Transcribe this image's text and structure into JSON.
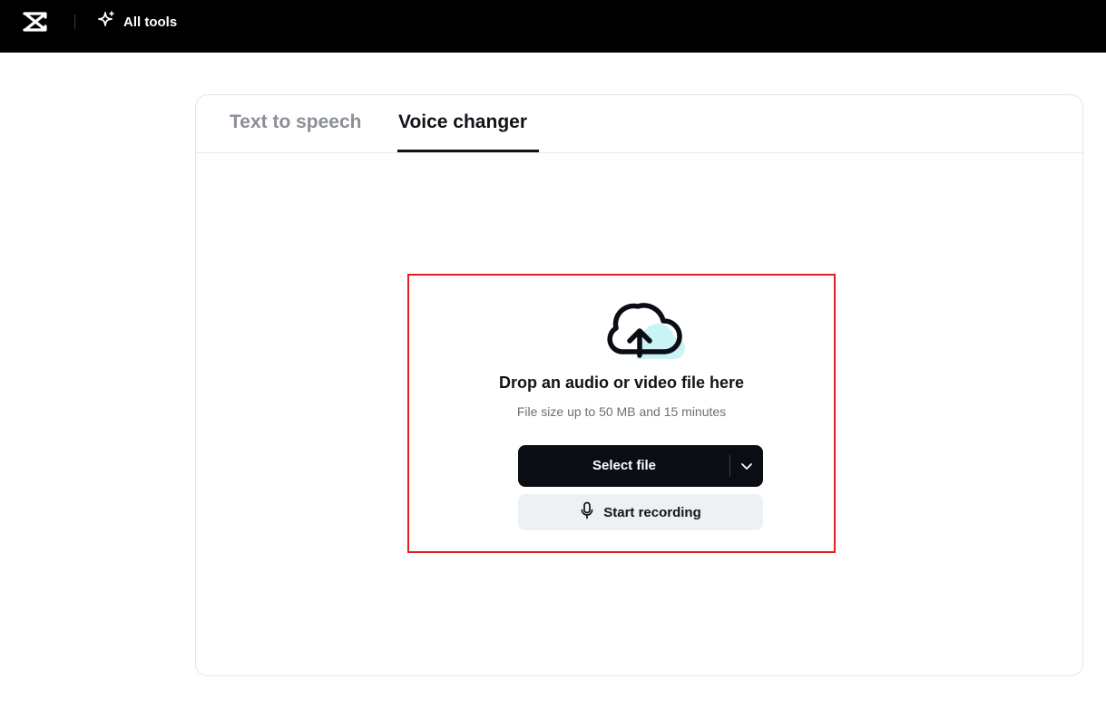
{
  "header": {
    "logo_icon": "capcut-logo-icon",
    "all_tools_icon": "sparkle-icon",
    "all_tools_label": "All tools"
  },
  "tabs": [
    {
      "label": "Text to speech",
      "active": false
    },
    {
      "label": "Voice changer",
      "active": true
    }
  ],
  "upload": {
    "icon": "cloud-upload-icon",
    "title": "Drop an audio or video file here",
    "subtitle": "File size up to 50 MB and 15 minutes",
    "select_button_label": "Select file",
    "dropdown_icon": "chevron-down-icon",
    "record_button_label": "Start recording",
    "record_icon": "microphone-icon"
  },
  "colors": {
    "topbar_bg": "#000000",
    "primary_button_bg": "#0b0d14",
    "secondary_button_bg": "#eef1f4",
    "highlight_border": "#e02020",
    "cloud_accent": "#c9f3f7"
  }
}
